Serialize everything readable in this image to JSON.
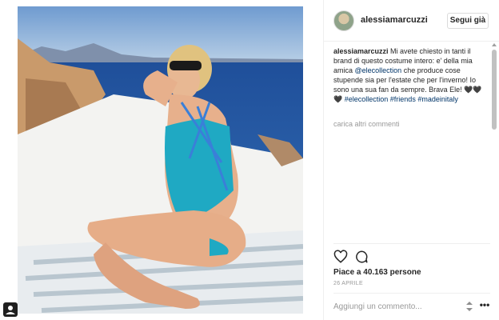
{
  "post": {
    "photo_alt": "",
    "header": {
      "username": "alessiamarcuzzi",
      "follow_label": "Segui già"
    },
    "caption": {
      "author": "alessiamarcuzzi",
      "text_1": " Mi avete chiesto in tanti il brand di questo costume intero: e' della mia amica ",
      "mention": "@elecollection",
      "text_2": " che produce cose stupende sia per l'estate che per l'inverno! Io sono una sua fan da sempre. Brava Ele!",
      "emoji": "🖤🖤🖤",
      "hashtag_1": "#elecollection",
      "hashtag_2": "#friends",
      "hashtag_3": "#madeinitaly"
    },
    "load_more_label": "carica altri commenti",
    "likes_label": "Piace a 40.163 persone",
    "date_label": "26 APRILE",
    "comment_placeholder": "Aggiungi un commento...",
    "icons": {
      "like": "heart-icon",
      "comment": "comment-icon",
      "sort": "sort-icon",
      "more": "more-icon",
      "corner": "user-badge-icon"
    },
    "colors": {
      "link": "#003569",
      "muted": "#999999",
      "border": "#efefef"
    }
  }
}
